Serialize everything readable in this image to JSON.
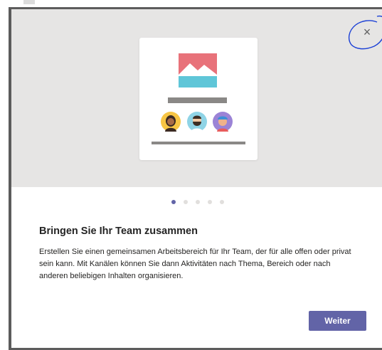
{
  "dialog": {
    "title": "Bringen Sie Ihr Team zusammen",
    "description": "Erstellen Sie einen gemeinsamen Arbeitsbereich für Ihr Team, der für alle offen oder privat sein kann. Mit Kanälen können Sie dann Aktivitäten nach Thema, Bereich oder nach anderen beliebigen Inhalten organisieren.",
    "close_icon": "×",
    "next_label": "Weiter",
    "pagination": {
      "total": 5,
      "current": 1
    }
  },
  "colors": {
    "accent": "#6264a7",
    "hero_background": "#e6e5e4",
    "annotation": "#1a3fd6"
  },
  "icons": [
    "close-icon",
    "landscape-image-icon",
    "avatar-icon"
  ]
}
